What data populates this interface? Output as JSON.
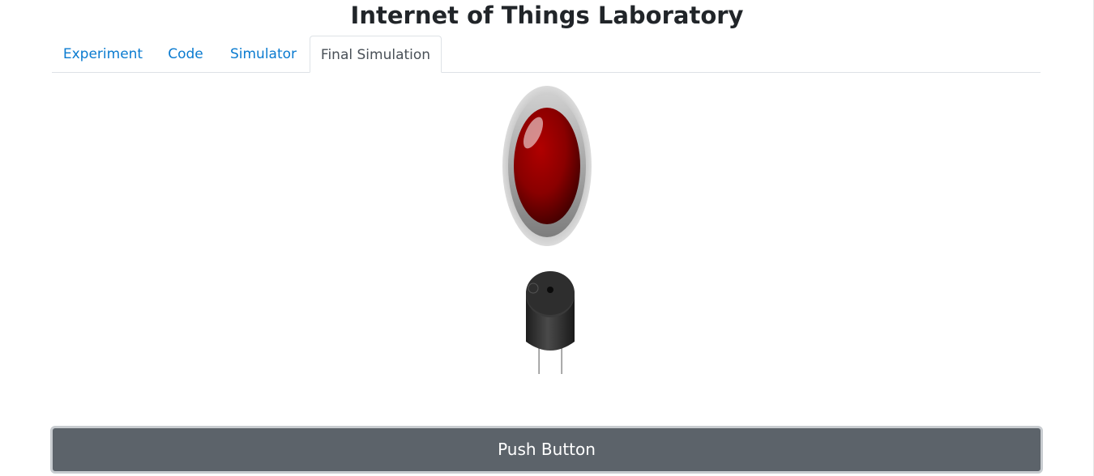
{
  "page": {
    "title": "Internet of Things Laboratory"
  },
  "tabs": [
    {
      "label": "Experiment",
      "active": false
    },
    {
      "label": "Code",
      "active": false
    },
    {
      "label": "Simulator",
      "active": false
    },
    {
      "label": "Final Simulation",
      "active": true
    }
  ],
  "simulation": {
    "led": {
      "icon": "red-led-icon",
      "state": "off",
      "color": "#8b0000"
    },
    "buzzer": {
      "icon": "buzzer-icon",
      "state": "off"
    }
  },
  "controls": {
    "push_button_label": "Push Button"
  },
  "colors": {
    "tab_link": "#0a7bd0",
    "tab_active_text": "#495057",
    "button_bg": "#5c636a",
    "button_border": "#c8ccd0"
  }
}
